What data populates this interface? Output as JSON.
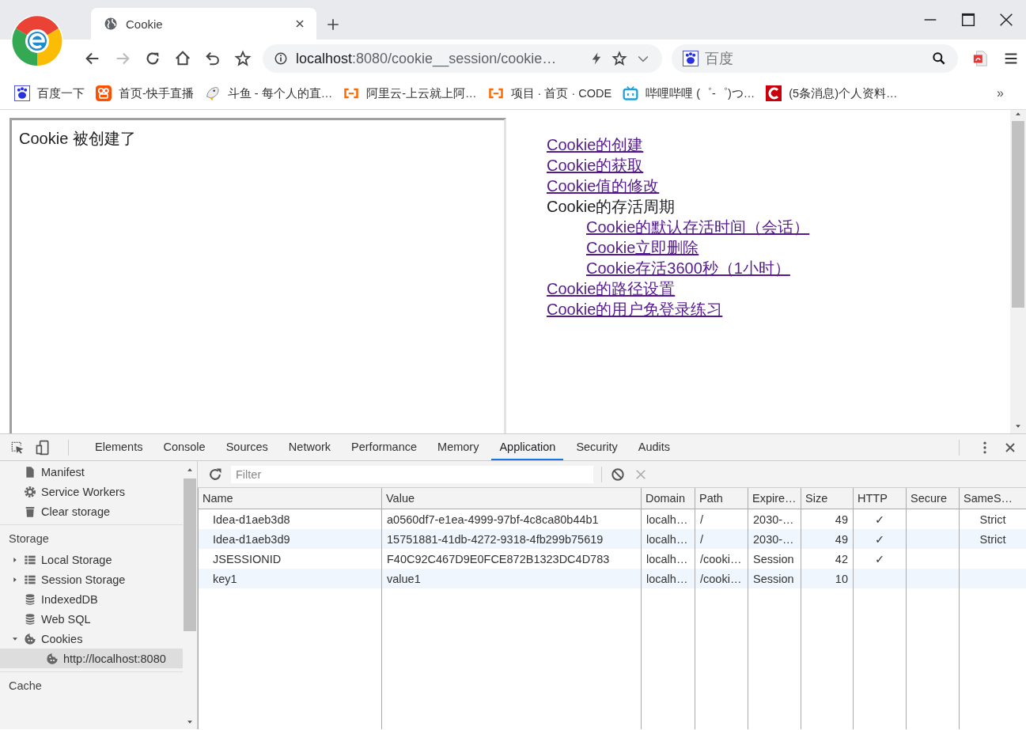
{
  "browser": {
    "tab": {
      "title": "Cookie",
      "selected": true
    },
    "address": {
      "host": "localhost",
      "rest": ":8080/cookie__session/cookie…"
    },
    "search": {
      "placeholder": "百度"
    },
    "bookmarks": [
      {
        "label": "百度一下",
        "kind": "paw"
      },
      {
        "label": "首页-快手直播",
        "kind": "app"
      },
      {
        "label": "斗鱼 - 每个人的直…",
        "kind": "fish"
      },
      {
        "label": "阿里云-上云就上阿…",
        "kind": "bracket"
      },
      {
        "label": "项目 · 首页 · CODE",
        "kind": "bracket"
      },
      {
        "label": "哔哩哔哩 (゜-゜)つ…",
        "kind": "tv"
      },
      {
        "label": "(5条消息)个人资料…",
        "kind": "letter"
      }
    ],
    "overflow": "»"
  },
  "page": {
    "frame_text": "Cookie 被创建了",
    "links": [
      {
        "label": "Cookie的创建",
        "kind": "link"
      },
      {
        "label": "Cookie的获取",
        "kind": "link"
      },
      {
        "label": "Cookie值的修改",
        "kind": "link"
      },
      {
        "label": "Cookie的存活周期",
        "kind": "text",
        "children": [
          {
            "label": "Cookie的默认存活时间（会话）",
            "kind": "link"
          },
          {
            "label": "Cookie立即删除",
            "kind": "link"
          },
          {
            "label": "Cookie存活3600秒（1小时）",
            "kind": "link"
          }
        ]
      },
      {
        "label": "Cookie的路径设置",
        "kind": "link"
      },
      {
        "label": "Cookie的用户免登录练习",
        "kind": "link"
      }
    ]
  },
  "devtools": {
    "tabs": [
      {
        "label": "Elements",
        "selected": false
      },
      {
        "label": "Console",
        "selected": false
      },
      {
        "label": "Sources",
        "selected": false
      },
      {
        "label": "Network",
        "selected": false
      },
      {
        "label": "Performance",
        "selected": false
      },
      {
        "label": "Memory",
        "selected": false
      },
      {
        "label": "Application",
        "selected": true
      },
      {
        "label": "Security",
        "selected": false
      },
      {
        "label": "Audits",
        "selected": false
      }
    ],
    "sidebar": [
      {
        "items": [
          {
            "label": "Manifest",
            "kind": "file",
            "selected": false
          },
          {
            "label": "Service Workers",
            "kind": "gear",
            "selected": false
          },
          {
            "label": "Clear storage",
            "kind": "trash",
            "selected": false
          }
        ]
      },
      {
        "heading": "Storage",
        "items": [
          {
            "label": "Local Storage",
            "kind": "grid",
            "expanded": false,
            "selected": false
          },
          {
            "label": "Session Storage",
            "kind": "grid",
            "expanded": false,
            "selected": false
          },
          {
            "label": "IndexedDB",
            "kind": "db",
            "selected": false
          },
          {
            "label": "Web SQL",
            "kind": "db",
            "selected": false
          },
          {
            "label": "Cookies",
            "kind": "cookie",
            "expanded": true,
            "selected": false,
            "children": [
              {
                "label": "http://localhost:8080",
                "kind": "cookie",
                "selected": true
              }
            ]
          }
        ]
      },
      {
        "heading": "Cache"
      }
    ],
    "filter": {
      "placeholder": "Filter"
    },
    "table": {
      "columns": [
        "Name",
        "Value",
        "Domain",
        "Path",
        "Expire…",
        "Size",
        "HTTP",
        "Secure",
        "SameS…"
      ],
      "rows": [
        [
          "Idea-d1aeb3d8",
          "a0560df7-e1ea-4999-97bf-4c8ca80b44b1",
          "localh…",
          "/",
          "2030-…",
          "49",
          "✓",
          "",
          "Strict"
        ],
        [
          "Idea-d1aeb3d9",
          "15751881-41db-4272-9318-4fb299b75619",
          "localh…",
          "/",
          "2030-…",
          "49",
          "✓",
          "",
          "Strict"
        ],
        [
          "JSESSIONID",
          "F40C92C467D9E0FCE872B1323DC4D783",
          "localh…",
          "/cooki…",
          "Session",
          "42",
          "✓",
          "",
          ""
        ],
        [
          "key1",
          "value1",
          "localh…",
          "/cooki…",
          "Session",
          "10",
          "",
          "",
          ""
        ]
      ]
    }
  }
}
